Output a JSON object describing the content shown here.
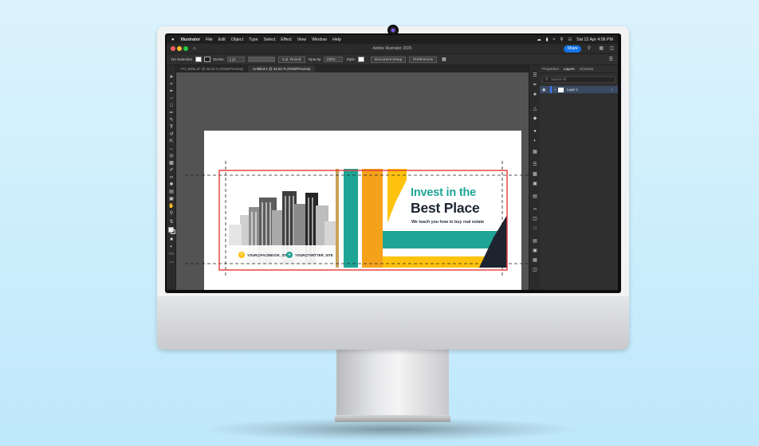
{
  "menubar": {
    "apple": "",
    "app": "Illustrator",
    "items": [
      "File",
      "Edit",
      "Object",
      "Type",
      "Select",
      "Effect",
      "View",
      "Window",
      "Help"
    ],
    "datetime": "Sat 12 Apr  4:06 PM"
  },
  "window": {
    "title": "Adobe Illustrator 2025",
    "share_label": "Share"
  },
  "options_bar": {
    "selection": "No Selection",
    "stroke_label": "Stroke:",
    "stroke_value": "1 pt",
    "brush_label": "3 pt. Round",
    "opacity_label": "Opacity:",
    "opacity_value": "100%",
    "style_label": "Style:",
    "document_setup": "Document Setup",
    "preferences": "Preferences"
  },
  "tabs": [
    {
      "label": "FH_WEB.ai* @ 66.63 % (RGB/Preview)",
      "active": false
    },
    {
      "label": "Untitled-1 @ 34.53 % (RGB/Preview)",
      "active": true
    }
  ],
  "panel": {
    "tabs": [
      "Properties",
      "Layers",
      "Libraries"
    ],
    "active_tab": "Layers",
    "search_placeholder": "Search All",
    "layers": [
      {
        "name": "Layer 1",
        "color": "#3d7bff"
      }
    ]
  },
  "design": {
    "headline_line1": "Invest in the",
    "headline_line2": "Best Place",
    "tagline": "We teach you how to buy real estate",
    "facebook": "YOUR@FACEBOOK_SITE",
    "twitter": "YOUR@TWITTER_SITE",
    "colors": {
      "teal": "#1fa595",
      "orange": "#f5a21b",
      "yellow": "#ffc20e",
      "navy": "#1d2430"
    }
  },
  "colors": {
    "accent": "#1473e6",
    "selection": "#e53935"
  }
}
